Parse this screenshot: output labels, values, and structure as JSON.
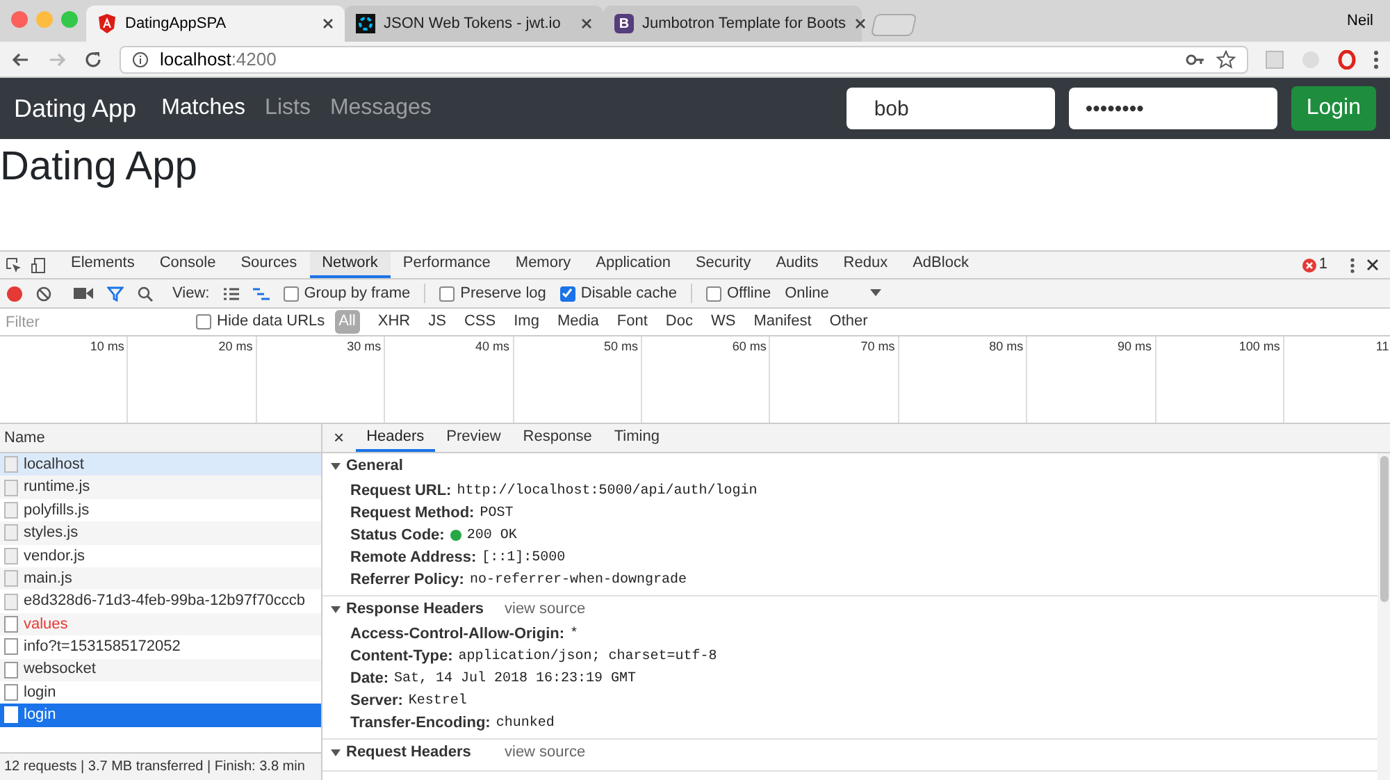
{
  "browser": {
    "tabs": [
      {
        "title": "DatingAppSPA",
        "kind": "angular",
        "selected": true
      },
      {
        "title": "JSON Web Tokens - jwt.io",
        "kind": "jwt",
        "selected": false
      },
      {
        "title": "Jumbotron Template for Boots",
        "kind": "bootstrap",
        "logo_letter": "B",
        "selected": false
      }
    ],
    "profile": "Neil",
    "url_host": "localhost",
    "url_port": ":4200"
  },
  "app": {
    "brand": "Dating App",
    "nav": [
      {
        "label": "Matches",
        "active": true
      },
      {
        "label": "Lists",
        "active": false
      },
      {
        "label": "Messages",
        "active": false
      }
    ],
    "username": "bob",
    "password": "••••••••",
    "login_button": "Login",
    "heading": "Dating App"
  },
  "devtools": {
    "tabs": [
      {
        "label": "Elements",
        "selected": false
      },
      {
        "label": "Console",
        "selected": false
      },
      {
        "label": "Sources",
        "selected": false
      },
      {
        "label": "Network",
        "selected": true
      },
      {
        "label": "Performance",
        "selected": false
      },
      {
        "label": "Memory",
        "selected": false
      },
      {
        "label": "Application",
        "selected": false
      },
      {
        "label": "Security",
        "selected": false
      },
      {
        "label": "Audits",
        "selected": false
      },
      {
        "label": "Redux",
        "selected": false
      },
      {
        "label": "AdBlock",
        "selected": false
      }
    ],
    "error_count": "1",
    "toolbar": {
      "recording": true,
      "view_label": "View:",
      "options": [
        {
          "label": "Group by frame",
          "checked": false
        },
        {
          "label": "Preserve log",
          "checked": false
        },
        {
          "label": "Disable cache",
          "checked": true
        },
        {
          "label": "Offline",
          "checked": false
        }
      ],
      "throttle": "Online"
    },
    "filter": {
      "placeholder": "Filter",
      "hide_data_urls": {
        "label": "Hide data URLs",
        "checked": false
      },
      "types": [
        {
          "label": "All",
          "selected": true
        },
        {
          "label": "XHR",
          "selected": false
        },
        {
          "label": "JS",
          "selected": false
        },
        {
          "label": "CSS",
          "selected": false
        },
        {
          "label": "Img",
          "selected": false
        },
        {
          "label": "Media",
          "selected": false
        },
        {
          "label": "Font",
          "selected": false
        },
        {
          "label": "Doc",
          "selected": false
        },
        {
          "label": "WS",
          "selected": false
        },
        {
          "label": "Manifest",
          "selected": false
        },
        {
          "label": "Other",
          "selected": false
        }
      ]
    },
    "timeline_ticks": [
      "10 ms",
      "20 ms",
      "30 ms",
      "40 ms",
      "50 ms",
      "60 ms",
      "70 ms",
      "80 ms",
      "90 ms",
      "100 ms",
      "11"
    ],
    "requests": {
      "column": "Name",
      "rows": [
        {
          "name": "localhost",
          "kind": "document",
          "selected": false,
          "highlighted": true,
          "failed": false
        },
        {
          "name": "runtime.js",
          "kind": "document",
          "selected": false,
          "highlighted": false,
          "failed": false
        },
        {
          "name": "polyfills.js",
          "kind": "document",
          "selected": false,
          "highlighted": false,
          "failed": false
        },
        {
          "name": "styles.js",
          "kind": "document",
          "selected": false,
          "highlighted": false,
          "failed": false
        },
        {
          "name": "vendor.js",
          "kind": "document",
          "selected": false,
          "highlighted": false,
          "failed": false
        },
        {
          "name": "main.js",
          "kind": "document",
          "selected": false,
          "highlighted": false,
          "failed": false
        },
        {
          "name": "e8d328d6-71d3-4feb-99ba-12b97f70cccb",
          "kind": "document",
          "selected": false,
          "highlighted": false,
          "failed": false
        },
        {
          "name": "values",
          "kind": "blank",
          "selected": false,
          "highlighted": false,
          "failed": true
        },
        {
          "name": "info?t=1531585172052",
          "kind": "blank",
          "selected": false,
          "highlighted": false,
          "failed": false
        },
        {
          "name": "websocket",
          "kind": "blank",
          "selected": false,
          "highlighted": false,
          "failed": false
        },
        {
          "name": "login",
          "kind": "blank",
          "selected": false,
          "highlighted": false,
          "failed": false
        },
        {
          "name": "login",
          "kind": "blank",
          "selected": true,
          "highlighted": false,
          "failed": false
        }
      ],
      "status": "12 requests | 3.7 MB transferred | Finish: 3.8 min"
    },
    "details": {
      "close": "×",
      "tabs": [
        {
          "label": "Headers",
          "selected": true
        },
        {
          "label": "Preview",
          "selected": false
        },
        {
          "label": "Response",
          "selected": false
        },
        {
          "label": "Timing",
          "selected": false
        }
      ],
      "sections": [
        {
          "title": "General",
          "expanded": true,
          "headers": [
            {
              "name": "Request URL:",
              "value": "http://localhost:5000/api/auth/login"
            },
            {
              "name": "Request Method:",
              "value": "POST"
            },
            {
              "name": "Status Code:",
              "value": "200 OK",
              "color": "#28a745"
            },
            {
              "name": "Remote Address:",
              "value": "[::1]:5000"
            },
            {
              "name": "Referrer Policy:",
              "value": "no-referrer-when-downgrade"
            }
          ]
        },
        {
          "title": "Response Headers",
          "expanded": true,
          "link": "view source",
          "headers": [
            {
              "name": "Access-Control-Allow-Origin:",
              "value": "*"
            },
            {
              "name": "Content-Type:",
              "value": "application/json; charset=utf-8"
            },
            {
              "name": "Date:",
              "value": "Sat, 14 Jul 2018 16:23:19 GMT"
            },
            {
              "name": "Server:",
              "value": "Kestrel"
            },
            {
              "name": "Transfer-Encoding:",
              "value": "chunked"
            }
          ]
        },
        {
          "title": "Request Headers",
          "expanded": true,
          "link": "view source"
        }
      ]
    }
  }
}
